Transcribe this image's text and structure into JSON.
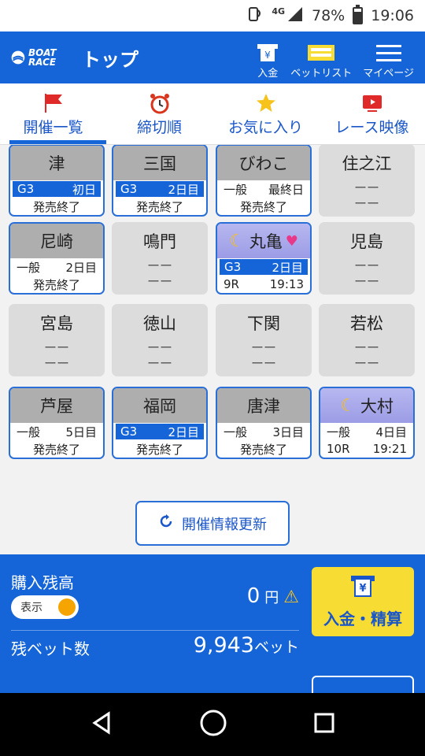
{
  "status": {
    "network": "4G",
    "battery": "78%",
    "time": "19:06"
  },
  "appbar": {
    "logo": "BOAT RACE",
    "title": "トップ",
    "buttons": [
      {
        "label": "入金",
        "icon": "deposit-icon"
      },
      {
        "label": "ベットリスト",
        "icon": "betlist-icon"
      },
      {
        "label": "マイページ",
        "icon": "menu-icon"
      }
    ]
  },
  "tabs": [
    {
      "label": "開催一覧",
      "icon": "flag-icon",
      "active": true
    },
    {
      "label": "締切順",
      "icon": "alarm-clock-icon"
    },
    {
      "label": "お気に入り",
      "icon": "star-icon"
    },
    {
      "label": "レース映像",
      "icon": "video-icon"
    }
  ],
  "venues": [
    {
      "name": "津",
      "state": "open",
      "grade": "G3",
      "day": "初日",
      "bottom": "発売終了"
    },
    {
      "name": "三国",
      "state": "open",
      "grade": "G3",
      "day": "2日目",
      "bottom": "発売終了"
    },
    {
      "name": "びわこ",
      "state": "open",
      "grade": "一般",
      "day": "最終日",
      "bottom": "発売終了"
    },
    {
      "name": "住之江",
      "state": "closed",
      "line1": "ーー",
      "line2": "ーー"
    },
    {
      "name": "尼崎",
      "state": "open",
      "grade": "一般",
      "day": "2日目",
      "bottom": "発売終了"
    },
    {
      "name": "鳴門",
      "state": "closed",
      "line1": "ーー",
      "line2": "ーー"
    },
    {
      "name": "丸亀",
      "state": "night",
      "grade": "G3",
      "day": "2日目",
      "race": "9R",
      "time": "19:13"
    },
    {
      "name": "児島",
      "state": "closed",
      "line1": "ーー",
      "line2": "ーー"
    },
    {
      "name": "宮島",
      "state": "closed",
      "line1": "ーー",
      "line2": "ーー"
    },
    {
      "name": "徳山",
      "state": "closed",
      "line1": "ーー",
      "line2": "ーー"
    },
    {
      "name": "下関",
      "state": "closed",
      "line1": "ーー",
      "line2": "ーー"
    },
    {
      "name": "若松",
      "state": "closed",
      "line1": "ーー",
      "line2": "ーー"
    },
    {
      "name": "芦屋",
      "state": "open",
      "grade": "一般",
      "day": "5日目",
      "bottom": "発売終了"
    },
    {
      "name": "福岡",
      "state": "open",
      "grade": "G3",
      "day": "2日目",
      "bottom": "発売終了"
    },
    {
      "name": "唐津",
      "state": "open",
      "grade": "一般",
      "day": "3日目",
      "bottom": "発売終了"
    },
    {
      "name": "大村",
      "state": "night",
      "grade": "一般",
      "day": "4日目",
      "race": "10R",
      "time": "19:21"
    }
  ],
  "refresh_button": "開催情報更新",
  "bottom": {
    "balance_label": "購入残高",
    "toggle_label": "表示",
    "balance_value": "0",
    "balance_unit": "円",
    "bets_label": "残ベット数",
    "bets_value": "9,943",
    "bets_unit": "ベット",
    "deposit_button": "入金・精算"
  },
  "colors": {
    "primary": "#1565d8",
    "accent_yellow": "#f7dc33",
    "toggle_orange": "#f6a500"
  }
}
